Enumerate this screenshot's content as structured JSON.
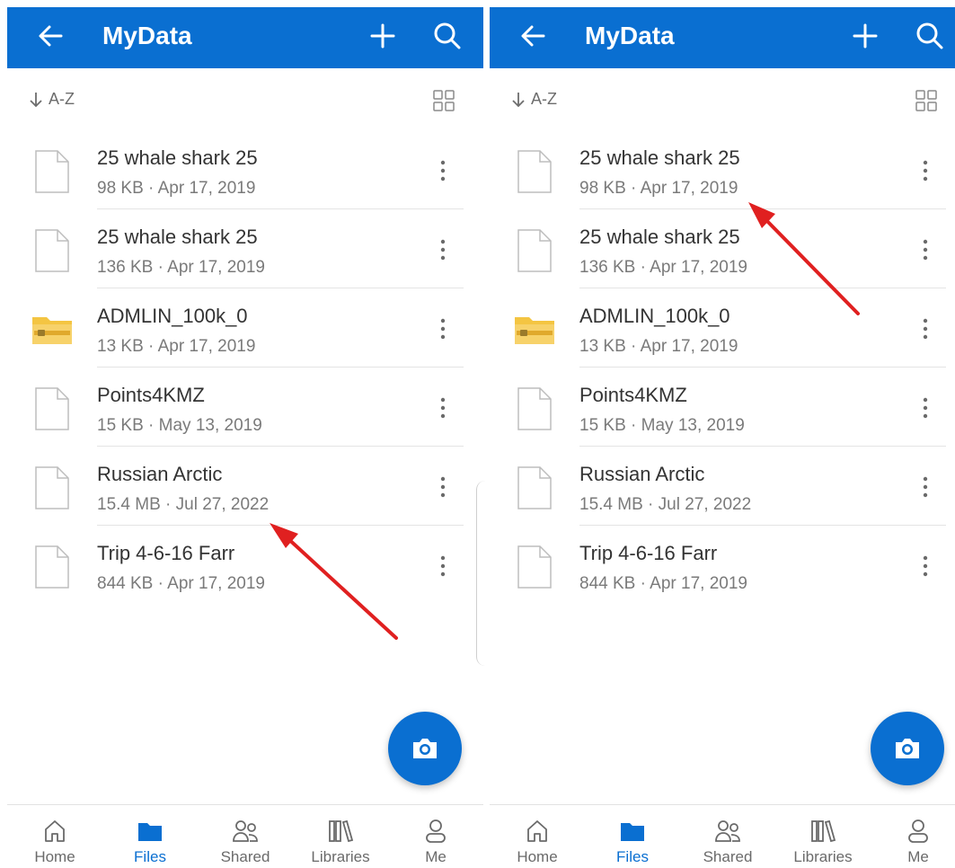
{
  "panels": [
    {
      "app_title": "MyData",
      "sort_label": "A-Z",
      "files": [
        {
          "name": "25 whale shark 25",
          "meta": "98 KB · Apr 17, 2019",
          "icon": "file-icon"
        },
        {
          "name": "25 whale shark 25",
          "meta": "136 KB · Apr 17, 2019",
          "icon": "file-icon"
        },
        {
          "name": "ADMLIN_100k_0",
          "meta": "13 KB · Apr 17, 2019",
          "icon": "zip-folder-icon"
        },
        {
          "name": "Points4KMZ",
          "meta": "15 KB · May 13, 2019",
          "icon": "file-icon"
        },
        {
          "name": "Russian Arctic",
          "meta": "15.4 MB · Jul 27, 2022",
          "icon": "file-icon"
        },
        {
          "name": "Trip 4-6-16 Farr",
          "meta": "844 KB · Apr 17, 2019",
          "icon": "file-icon"
        }
      ],
      "nav": [
        {
          "label": "Home",
          "icon": "home-icon"
        },
        {
          "label": "Files",
          "icon": "folder-icon",
          "active": true
        },
        {
          "label": "Shared",
          "icon": "people-icon"
        },
        {
          "label": "Libraries",
          "icon": "libraries-icon"
        },
        {
          "label": "Me",
          "icon": "person-icon"
        }
      ]
    },
    {
      "app_title": "MyData",
      "sort_label": "A-Z",
      "files": [
        {
          "name": "25 whale shark 25",
          "meta": "98 KB · Apr 17, 2019",
          "icon": "file-icon"
        },
        {
          "name": "25 whale shark 25",
          "meta": "136 KB · Apr 17, 2019",
          "icon": "file-icon"
        },
        {
          "name": "ADMLIN_100k_0",
          "meta": "13 KB · Apr 17, 2019",
          "icon": "zip-folder-icon"
        },
        {
          "name": "Points4KMZ",
          "meta": "15 KB · May 13, 2019",
          "icon": "file-icon"
        },
        {
          "name": "Russian Arctic",
          "meta": "15.4 MB · Jul 27, 2022",
          "icon": "file-icon"
        },
        {
          "name": "Trip 4-6-16 Farr",
          "meta": "844 KB · Apr 17, 2019",
          "icon": "file-icon"
        }
      ],
      "nav": [
        {
          "label": "Home",
          "icon": "home-icon"
        },
        {
          "label": "Files",
          "icon": "folder-icon",
          "active": true
        },
        {
          "label": "Shared",
          "icon": "people-icon"
        },
        {
          "label": "Libraries",
          "icon": "libraries-icon"
        },
        {
          "label": "Me",
          "icon": "person-icon"
        }
      ]
    }
  ],
  "colors": {
    "brand": "#0a6fd1",
    "annotation_arrow": "#e02020",
    "zip_folder": "#f4c542"
  }
}
